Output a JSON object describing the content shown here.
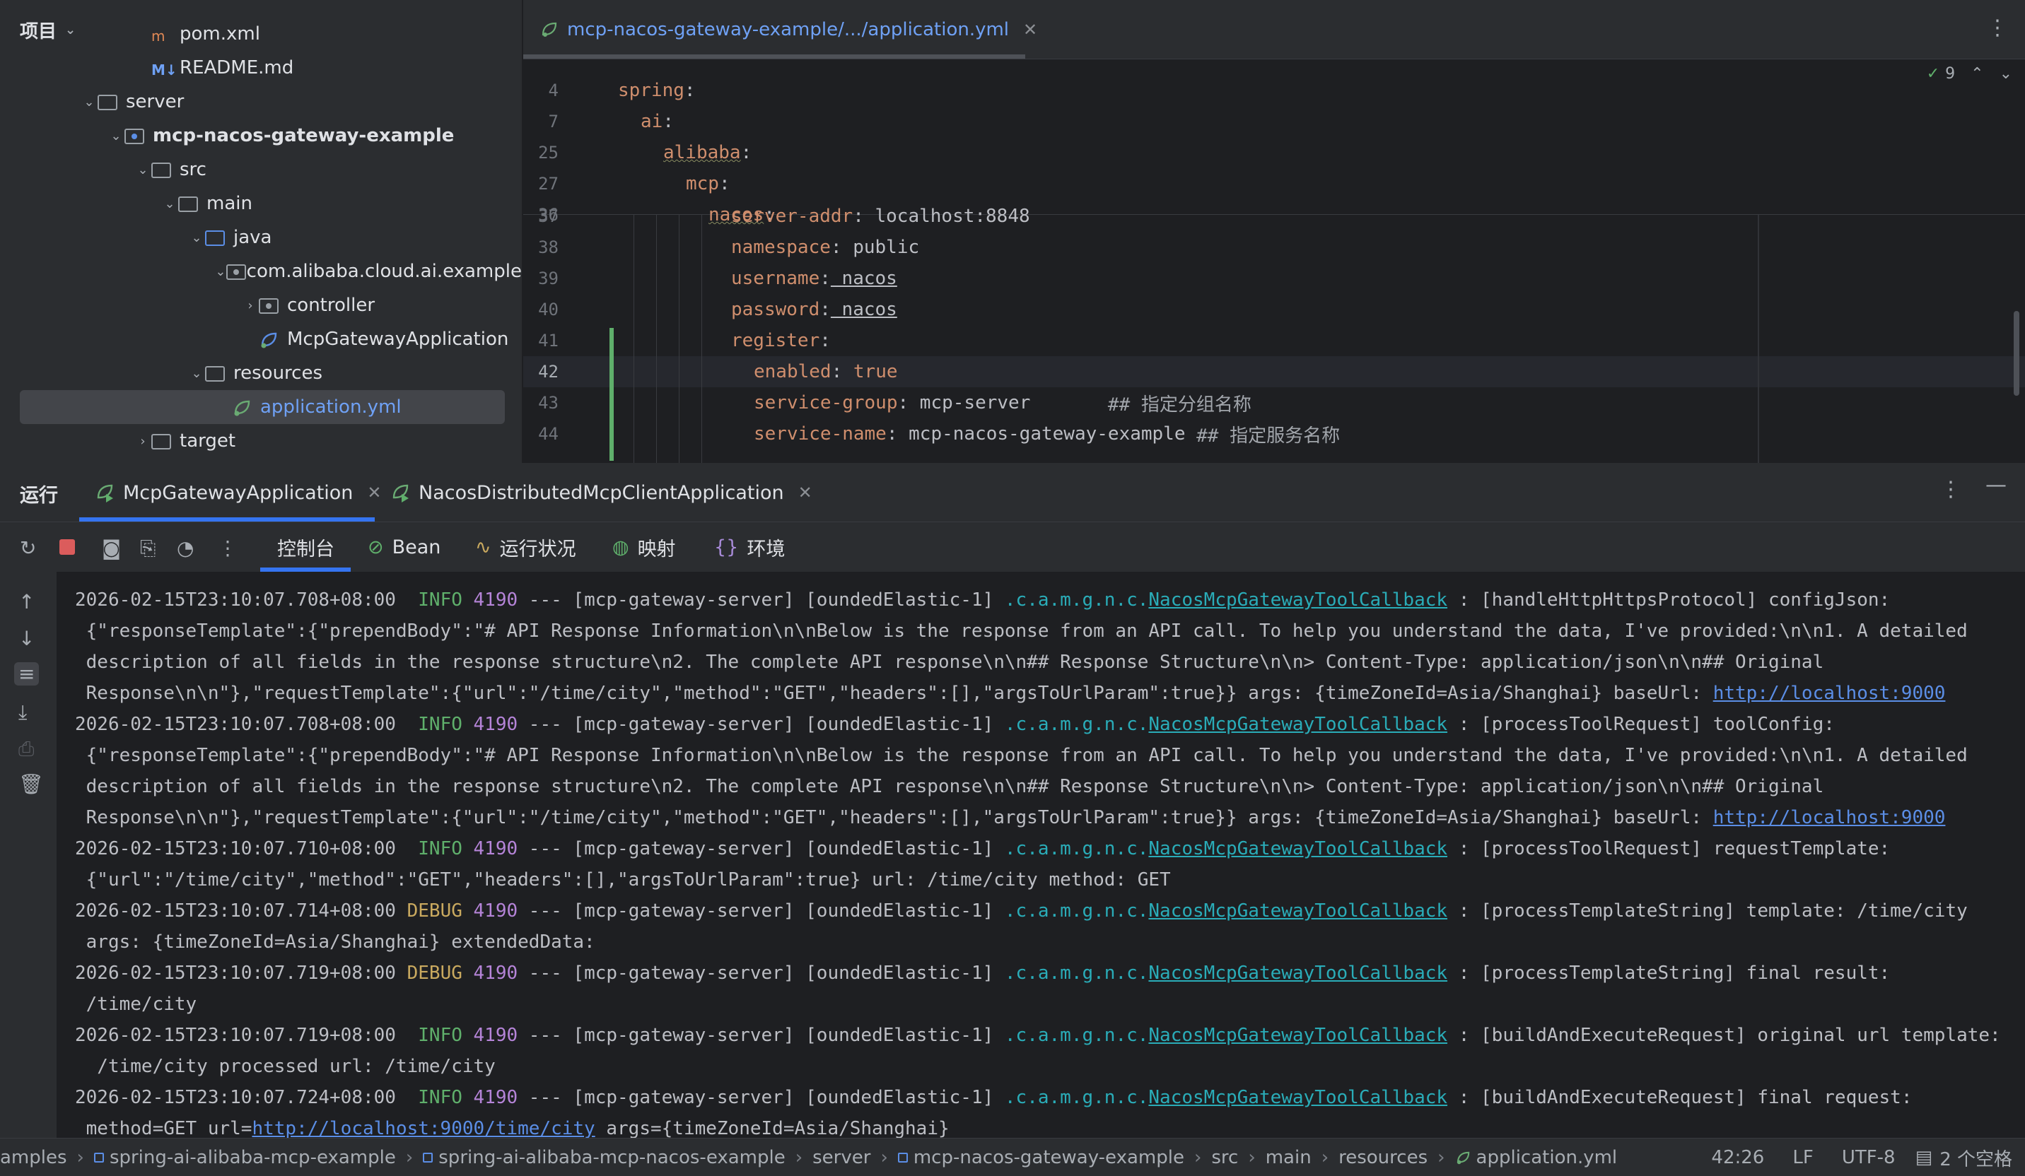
{
  "project_panel": {
    "title": "项目",
    "items": [
      {
        "label": "pom.xml",
        "indent": 5,
        "icon": "xml-file-icon"
      },
      {
        "label": "README.md",
        "indent": 5,
        "icon": "markdown-file-icon"
      },
      {
        "label": "server",
        "indent": 3,
        "icon": "folder-icon",
        "expanded": true
      },
      {
        "label": "mcp-nacos-gateway-example",
        "indent": 4,
        "icon": "module-folder-icon",
        "expanded": true,
        "bold": true
      },
      {
        "label": "src",
        "indent": 5,
        "icon": "folder-icon",
        "expanded": true
      },
      {
        "label": "main",
        "indent": 6,
        "icon": "folder-icon",
        "expanded": true
      },
      {
        "label": "java",
        "indent": 7,
        "icon": "source-folder-icon",
        "expanded": true
      },
      {
        "label": "com.alibaba.cloud.ai.example",
        "indent": 8,
        "icon": "package-icon",
        "expanded": true
      },
      {
        "label": "controller",
        "indent": 9,
        "icon": "package-icon",
        "expanded": false
      },
      {
        "label": "McpGatewayApplication",
        "indent": 9,
        "icon": "spring-class-icon"
      },
      {
        "label": "resources",
        "indent": 7,
        "icon": "folder-icon",
        "expanded": true
      },
      {
        "label": "application.yml",
        "indent": 8,
        "icon": "yaml-file-icon",
        "selected": true
      },
      {
        "label": "target",
        "indent": 5,
        "icon": "folder-icon",
        "expanded": false
      }
    ]
  },
  "editor": {
    "tab_label": "mcp-nacos-gateway-example/.../application.yml",
    "inspection_count": "9",
    "sticky_lines": [
      {
        "ln": "4",
        "indent": 0,
        "key": "spring",
        "squig": false
      },
      {
        "ln": "7",
        "indent": 1,
        "key": "ai",
        "squig": false
      },
      {
        "ln": "25",
        "indent": 2,
        "key": "alibaba",
        "squig": true
      },
      {
        "ln": "27",
        "indent": 3,
        "key": "mcp",
        "squig": false
      },
      {
        "ln": "36",
        "indent": 4,
        "key": "nacos",
        "squig": true
      }
    ],
    "lines": [
      {
        "ln": "37",
        "indent": 5,
        "key": "server-addr",
        "value": "localhost:8848",
        "comment": ""
      },
      {
        "ln": "38",
        "indent": 5,
        "key": "namespace",
        "value": "public",
        "comment": ""
      },
      {
        "ln": "39",
        "indent": 5,
        "key": "username",
        "value": "nacos",
        "comment": ""
      },
      {
        "ln": "40",
        "indent": 5,
        "key": "password",
        "value": "nacos",
        "comment": ""
      },
      {
        "ln": "41",
        "indent": 5,
        "key": "register",
        "value": "",
        "comment": ""
      },
      {
        "ln": "42",
        "indent": 6,
        "key": "enabled",
        "value": "true",
        "comment": ""
      },
      {
        "ln": "43",
        "indent": 6,
        "key": "service-group",
        "value": "mcp-server",
        "comment": "## 指定分组名称"
      },
      {
        "ln": "44",
        "indent": 6,
        "key": "service-name",
        "value": "mcp-nacos-gateway-example",
        "comment": "## 指定服务名称"
      }
    ]
  },
  "run": {
    "label": "运行",
    "tabs": [
      "McpGatewayApplication",
      "NacosDistributedMcpClientApplication"
    ],
    "toolbar_tabs": [
      "控制台",
      "Bean",
      "运行状况",
      "映射",
      "环境"
    ],
    "console_lines": [
      {
        "ts": "2026-02-15T23:10:07.708+08:00",
        "level": " INFO",
        "pid": "4190",
        "mid": " --- [mcp-gateway-server] [oundedElastic-1] ",
        "lpre": ".c.a.m.g.n.c.",
        "lname": "NacosMcpGatewayToolCallback",
        "msg": " : [handleHttpHttpsProtocol] configJson:"
      },
      {
        "cont": " {\"responseTemplate\":{\"prependBody\":\"# API Response Information\\n\\nBelow is the response from an API call. To help you understand the data, I've provided:\\n\\n1. A detailed"
      },
      {
        "cont": " description of all fields in the response structure\\n2. The complete API response\\n\\n## Response Structure\\n\\n> Content-Type: application/json\\n\\n## Original"
      },
      {
        "cont": " Response\\n\\n\"},\"requestTemplate\":{\"url\":\"/time/city\",\"method\":\"GET\",\"headers\":[],\"argsToUrlParam\":true}} args: {timeZoneId=Asia/Shanghai} baseUrl: ",
        "url": "http://localhost:9000"
      },
      {
        "ts": "2026-02-15T23:10:07.708+08:00",
        "level": " INFO",
        "pid": "4190",
        "mid": " --- [mcp-gateway-server] [oundedElastic-1] ",
        "lpre": ".c.a.m.g.n.c.",
        "lname": "NacosMcpGatewayToolCallback",
        "msg": " : [processToolRequest] toolConfig:"
      },
      {
        "cont": " {\"responseTemplate\":{\"prependBody\":\"# API Response Information\\n\\nBelow is the response from an API call. To help you understand the data, I've provided:\\n\\n1. A detailed"
      },
      {
        "cont": " description of all fields in the response structure\\n2. The complete API response\\n\\n## Response Structure\\n\\n> Content-Type: application/json\\n\\n## Original"
      },
      {
        "cont": " Response\\n\\n\"},\"requestTemplate\":{\"url\":\"/time/city\",\"method\":\"GET\",\"headers\":[],\"argsToUrlParam\":true}} args: {timeZoneId=Asia/Shanghai} baseUrl: ",
        "url": "http://localhost:9000"
      },
      {
        "ts": "2026-02-15T23:10:07.710+08:00",
        "level": " INFO",
        "pid": "4190",
        "mid": " --- [mcp-gateway-server] [oundedElastic-1] ",
        "lpre": ".c.a.m.g.n.c.",
        "lname": "NacosMcpGatewayToolCallback",
        "msg": " : [processToolRequest] requestTemplate:"
      },
      {
        "cont": " {\"url\":\"/time/city\",\"method\":\"GET\",\"headers\":[],\"argsToUrlParam\":true} url: /time/city method: GET"
      },
      {
        "ts": "2026-02-15T23:10:07.714+08:00",
        "level": "DEBUG",
        "pid": "4190",
        "mid": " --- [mcp-gateway-server] [oundedElastic-1] ",
        "lpre": ".c.a.m.g.n.c.",
        "lname": "NacosMcpGatewayToolCallback",
        "msg": " : [processTemplateString] template: /time/city"
      },
      {
        "cont": " args: {timeZoneId=Asia/Shanghai} extendedData:"
      },
      {
        "ts": "2026-02-15T23:10:07.719+08:00",
        "level": "DEBUG",
        "pid": "4190",
        "mid": " --- [mcp-gateway-server] [oundedElastic-1] ",
        "lpre": ".c.a.m.g.n.c.",
        "lname": "NacosMcpGatewayToolCallback",
        "msg": " : [processTemplateString] final result:"
      },
      {
        "cont": " /time/city"
      },
      {
        "ts": "2026-02-15T23:10:07.719+08:00",
        "level": " INFO",
        "pid": "4190",
        "mid": " --- [mcp-gateway-server] [oundedElastic-1] ",
        "lpre": ".c.a.m.g.n.c.",
        "lname": "NacosMcpGatewayToolCallback",
        "msg": " : [buildAndExecuteRequest] original url template:"
      },
      {
        "cont": "  /time/city processed url: /time/city"
      },
      {
        "ts": "2026-02-15T23:10:07.724+08:00",
        "level": " INFO",
        "pid": "4190",
        "mid": " --- [mcp-gateway-server] [oundedElastic-1] ",
        "lpre": ".c.a.m.g.n.c.",
        "lname": "NacosMcpGatewayToolCallback",
        "msg": " : [buildAndExecuteRequest] final request:"
      },
      {
        "cont": " method=GET url=",
        "url": "http://localhost:9000/time/city",
        "after": " args={timeZoneId=Asia/Shanghai}"
      }
    ]
  },
  "status_bar": {
    "breadcrumbs": [
      "amples",
      "spring-ai-alibaba-mcp-example",
      "spring-ai-alibaba-mcp-nacos-example",
      "server",
      "mcp-nacos-gateway-example",
      "src",
      "main",
      "resources",
      "application.yml"
    ],
    "position": "42:26",
    "line_sep": "LF",
    "encoding": "UTF-8",
    "indent": "2 个空格"
  }
}
